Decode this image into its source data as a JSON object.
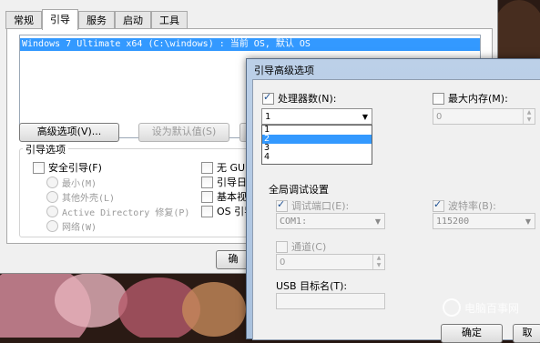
{
  "main_window": {
    "tabs": [
      "常规",
      "引导",
      "服务",
      "启动",
      "工具"
    ],
    "active_tab": 1,
    "os_entry": "Windows 7 Ultimate x64 (C:\\windows) : 当前 OS, 默认 OS",
    "advanced_button": "高级选项(V)...",
    "set_default_button": "设为默认值(S)",
    "boot_options_title": "引导选项",
    "safe_boot_label": "安全引导(F)",
    "safe_boot_options": [
      "最小(M)",
      "其他外壳(L)",
      "Active Directory 修复(P)",
      "网络(W)"
    ],
    "right_options": [
      "无 GUI",
      "引导日志",
      "基本视频",
      "OS 引导"
    ],
    "ok_button_partial": "确"
  },
  "advanced_dialog": {
    "title": "引导高级选项",
    "processor_count_label": "处理器数(N):",
    "processor_count_checked": true,
    "processor_selected": "1",
    "processor_options": [
      "1",
      "2",
      "3",
      "4"
    ],
    "processor_highlighted": "2",
    "max_memory_label": "最大内存(M):",
    "max_memory_value": "0",
    "global_debug_title": "全局调试设置",
    "debug_port_label": "调试端口(E):",
    "debug_port_value": "COM1:",
    "baud_rate_label": "波特率(B):",
    "baud_rate_value": "115200",
    "channel_label": "通道(C)",
    "channel_value": "0",
    "usb_target_label": "USB 目标名(T):",
    "ok_button": "确定",
    "cancel_button_partial": "取"
  },
  "watermark": "电脑百事网",
  "colors": {
    "selection": "#3399ff",
    "dialog_frame": "#b2c8e4",
    "window_bg": "#f0f0f0"
  }
}
